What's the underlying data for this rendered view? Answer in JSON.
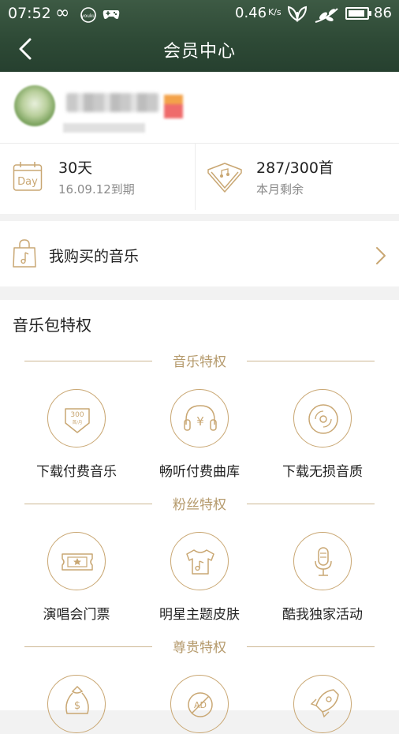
{
  "status_bar": {
    "time": "07:52",
    "speed": "0.46",
    "speed_unit": "K/s",
    "battery": "86"
  },
  "navbar": {
    "title": "会员中心"
  },
  "stats": {
    "days": {
      "value": "30天",
      "sub": "16.09.12到期",
      "icon_label": "Day"
    },
    "songs": {
      "value": "287/300首",
      "sub": "本月剩余"
    }
  },
  "purchased": {
    "label": "我购买的音乐"
  },
  "privileges": {
    "title": "音乐包特权",
    "categories": [
      {
        "title": "音乐特权",
        "items": [
          {
            "label": "下载付费音乐",
            "icon": "download-300-icon",
            "icon_text": "300",
            "icon_subtext": "首/月"
          },
          {
            "label": "畅听付费曲库",
            "icon": "headphones-yen-icon",
            "icon_text": "¥"
          },
          {
            "label": "下载无损音质",
            "icon": "disc-icon"
          }
        ]
      },
      {
        "title": "粉丝特权",
        "items": [
          {
            "label": "演唱会门票",
            "icon": "ticket-star-icon"
          },
          {
            "label": "明星主题皮肤",
            "icon": "tshirt-music-icon"
          },
          {
            "label": "酷我独家活动",
            "icon": "microphone-icon"
          }
        ]
      },
      {
        "title": "尊贵特权",
        "items": [
          {
            "icon": "money-bag-icon"
          },
          {
            "icon": "no-ads-icon"
          },
          {
            "icon": "rocket-icon"
          }
        ]
      }
    ]
  },
  "colors": {
    "accent": "#c9a773",
    "header": "#2e4a36"
  }
}
